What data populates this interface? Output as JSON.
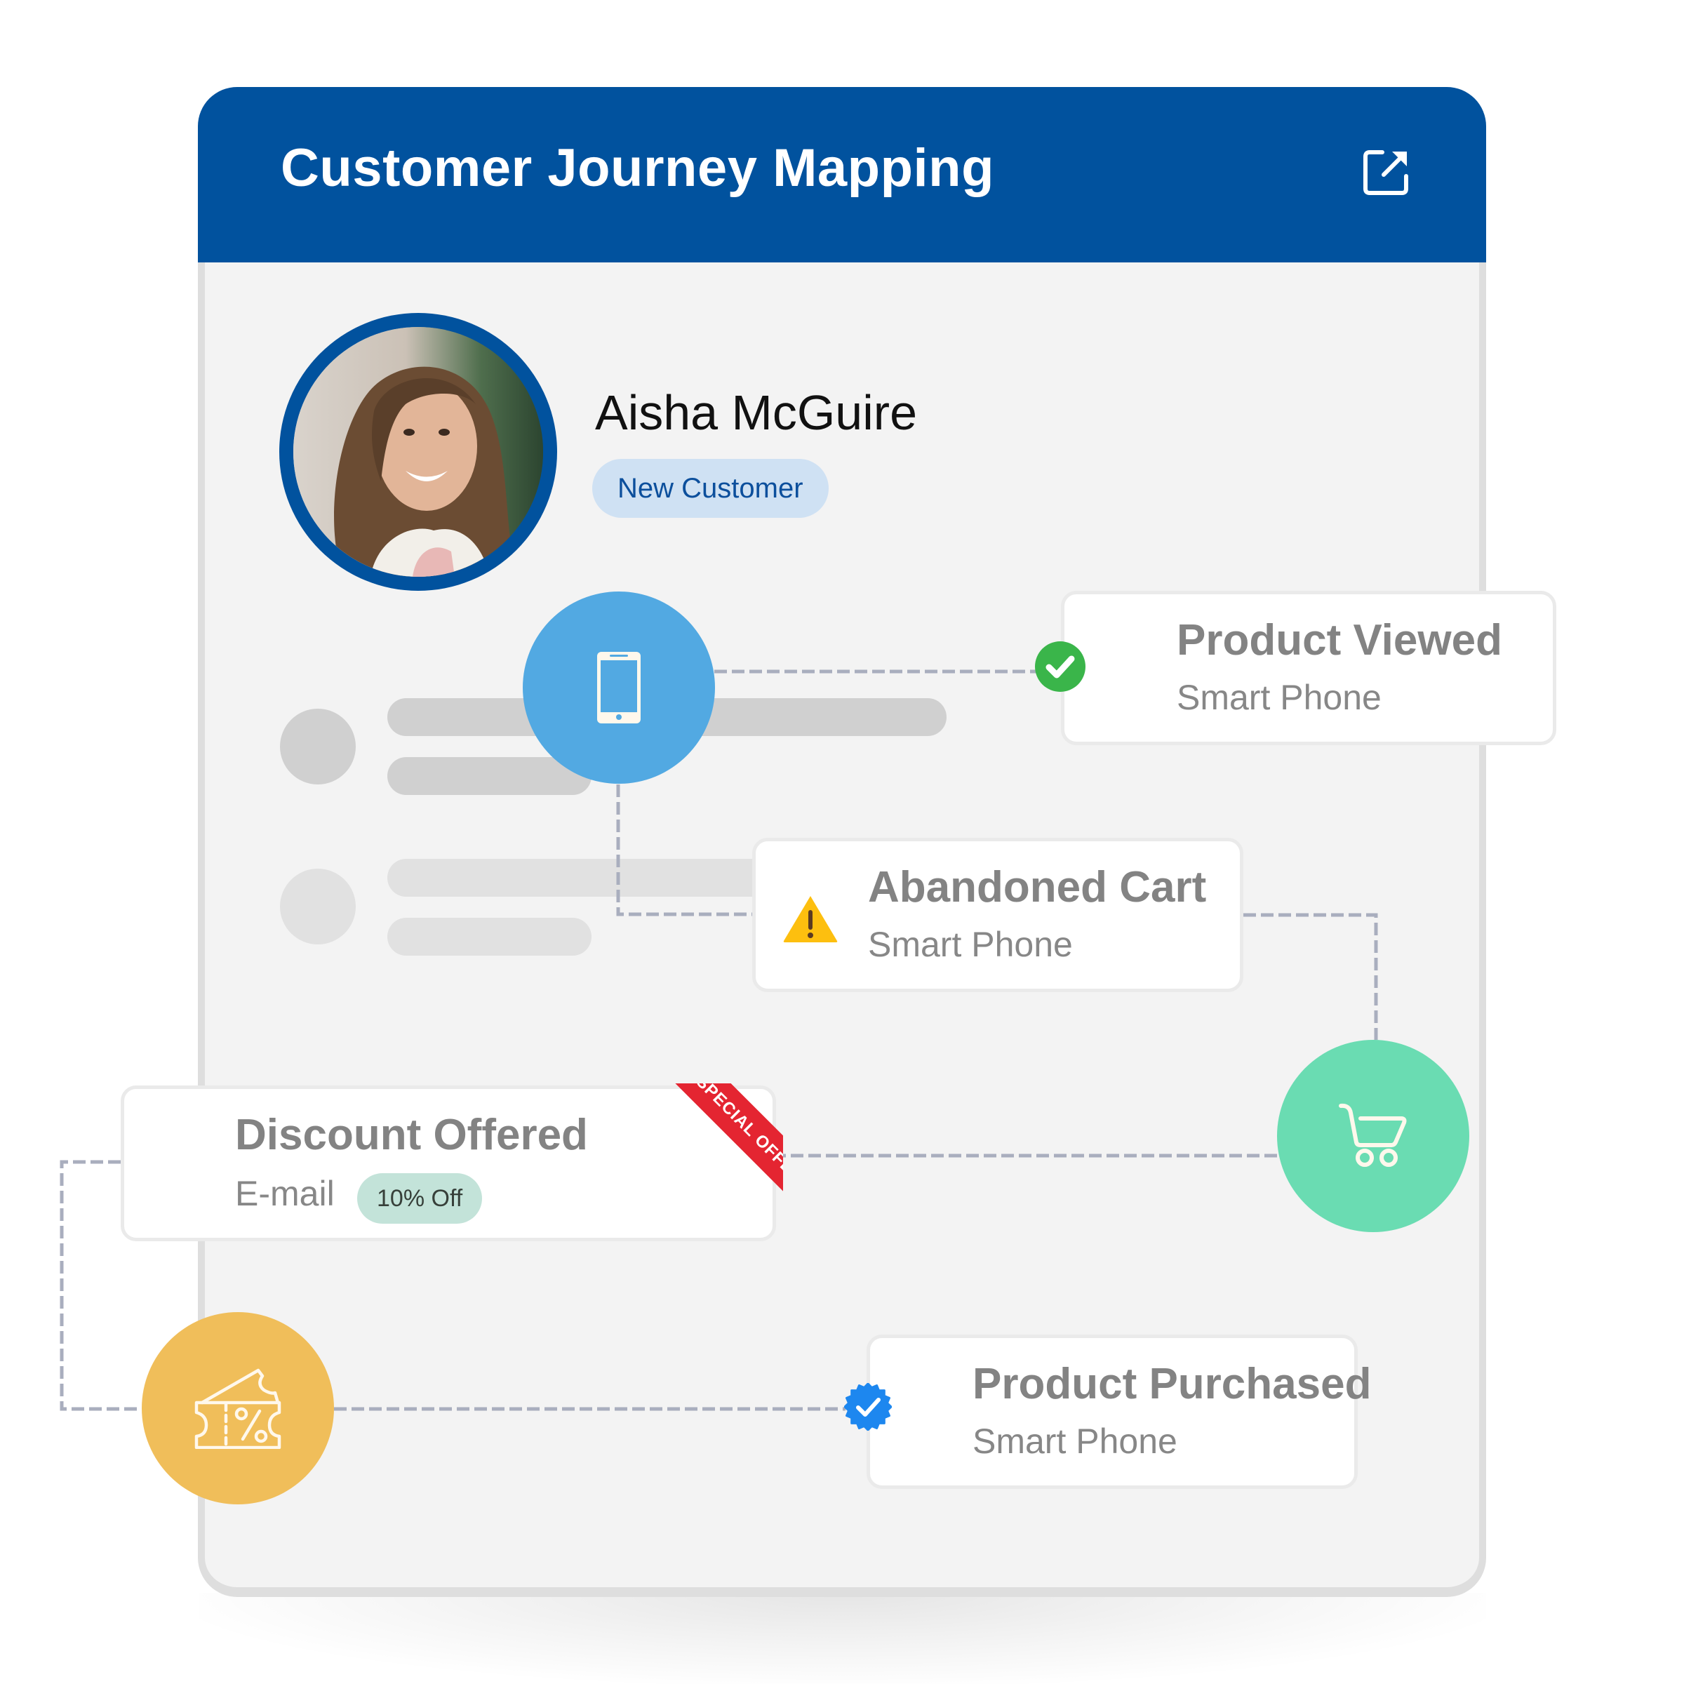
{
  "app": {
    "title": "Customer Journey Mapping",
    "open_external_icon": "external-link-icon"
  },
  "colors": {
    "header": "#01529e",
    "panel_bg": "#f3f3f3",
    "phone_step": "#52a9e2",
    "cart_step": "#6adcb2",
    "coupon_step": "#f0be5a",
    "success": "#3ab54a",
    "warning": "#fdbf0f",
    "verified": "#1d87ef",
    "ribbon": "#e42531",
    "connector": "#a9aebe"
  },
  "customer": {
    "name": "Aisha McGuire",
    "status_badge": "New Customer",
    "avatar_icon": "customer-photo"
  },
  "steps": [
    {
      "id": "phone",
      "icon": "smartphone-icon"
    },
    {
      "id": "cart",
      "icon": "shopping-cart-icon"
    },
    {
      "id": "coupon",
      "icon": "discount-coupon-icon"
    }
  ],
  "events": [
    {
      "title": "Product Viewed",
      "subtitle": "Smart Phone",
      "status_icon": "check-circle-icon"
    },
    {
      "title": "Abandoned Cart",
      "subtitle": "Smart Phone",
      "status_icon": "warning-icon"
    },
    {
      "title": "Discount Offered",
      "subtitle": "E-mail",
      "badge": "10% Off",
      "ribbon": "SPECIAL OFFER"
    },
    {
      "title": "Product Purchased",
      "subtitle": "Smart Phone",
      "status_icon": "verified-badge-icon"
    }
  ]
}
